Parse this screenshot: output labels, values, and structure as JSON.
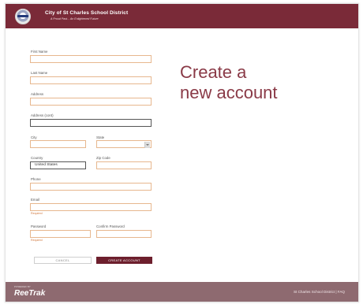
{
  "header": {
    "title": "City of St Charles School District",
    "tagline": "A Proud Past... An Enlightened Future"
  },
  "form": {
    "first_name_label": "First Name",
    "last_name_label": "Last Name",
    "address_label": "Address",
    "address_cont_label": "Address (cont)",
    "city_label": "City",
    "state_label": "State",
    "country_label": "Country",
    "country_value": "United States",
    "zip_label": "Zip Code",
    "phone_label": "Phone",
    "email_label": "Email",
    "email_required": "Required",
    "password_label": "Password",
    "password_required": "Required",
    "confirm_password_label": "Confirm Password",
    "cancel_label": "CANCEL",
    "create_label": "CREATE ACCOUNT"
  },
  "main": {
    "heading_line1": "Create a",
    "heading_line2": "new account"
  },
  "footer": {
    "powered_by": "POWERED BY",
    "brand": "ReeTrak",
    "links": "St Charles School District | FAQ"
  },
  "colors": {
    "brand_maroon": "#7a2a38",
    "field_border": "#e7b78e",
    "footer_bg": "#8e6a70"
  },
  "icons": [
    "district-seal-icon",
    "select-arrow-icon"
  ]
}
